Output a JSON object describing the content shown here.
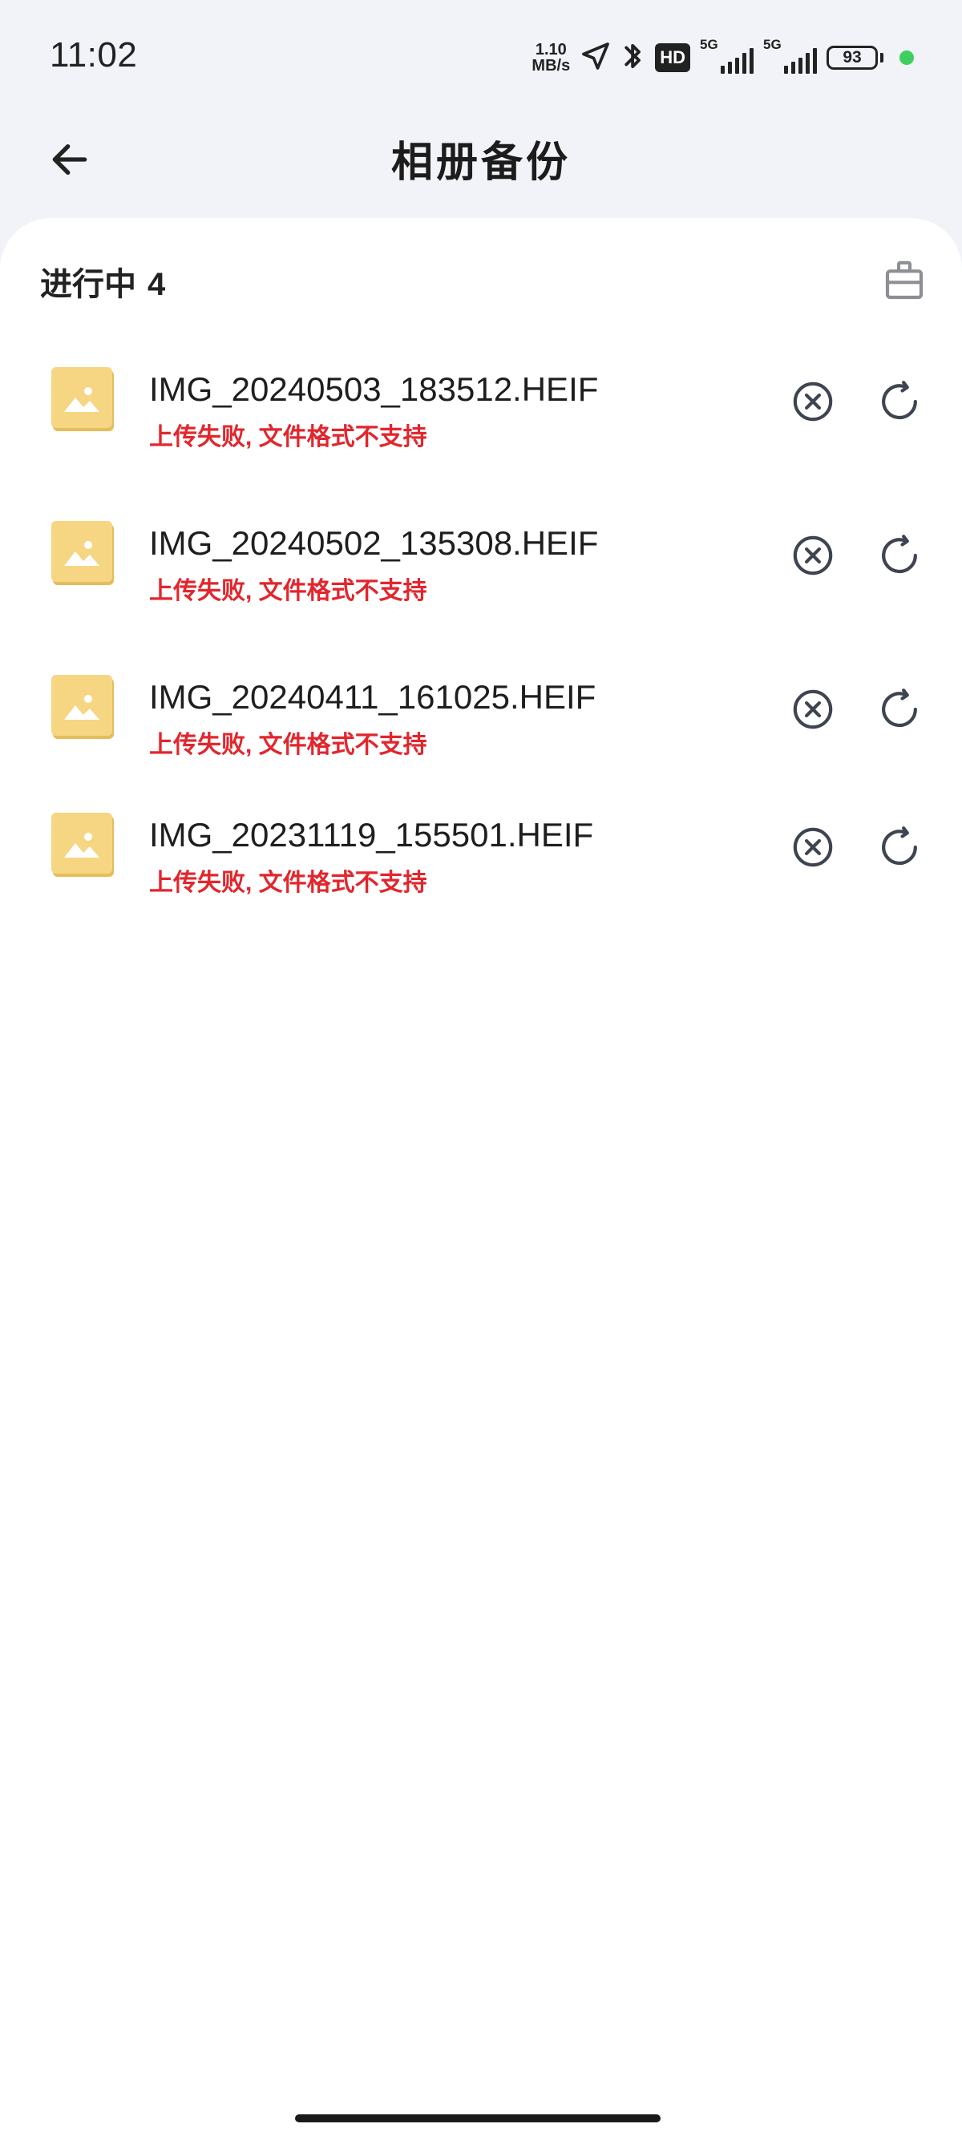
{
  "status_bar": {
    "time": "11:02",
    "net_speed_value": "1.10",
    "net_speed_unit": "MB/s",
    "hd_label": "HD",
    "sim1_label": "5G",
    "sim2_label": "5G",
    "battery_level": "93",
    "icons": [
      "location-arrow-icon",
      "bluetooth-icon",
      "hd-icon",
      "signal-icon",
      "battery-icon",
      "privacy-dot"
    ]
  },
  "header": {
    "title": "相册备份"
  },
  "section": {
    "label": "进行中",
    "count": "4"
  },
  "items": [
    {
      "name": "IMG_20240503_183512.HEIF",
      "status": "上传失败, 文件格式不支持"
    },
    {
      "name": "IMG_20240502_135308.HEIF",
      "status": "上传失败, 文件格式不支持"
    },
    {
      "name": "IMG_20240411_161025.HEIF",
      "status": "上传失败, 文件格式不支持"
    },
    {
      "name": "IMG_20231119_155501.HEIF",
      "status": "上传失败, 文件格式不支持"
    }
  ],
  "colors": {
    "accent_error": "#e2262d",
    "thumb_yellow": "#f6d682",
    "background": "#f1f3f8"
  }
}
